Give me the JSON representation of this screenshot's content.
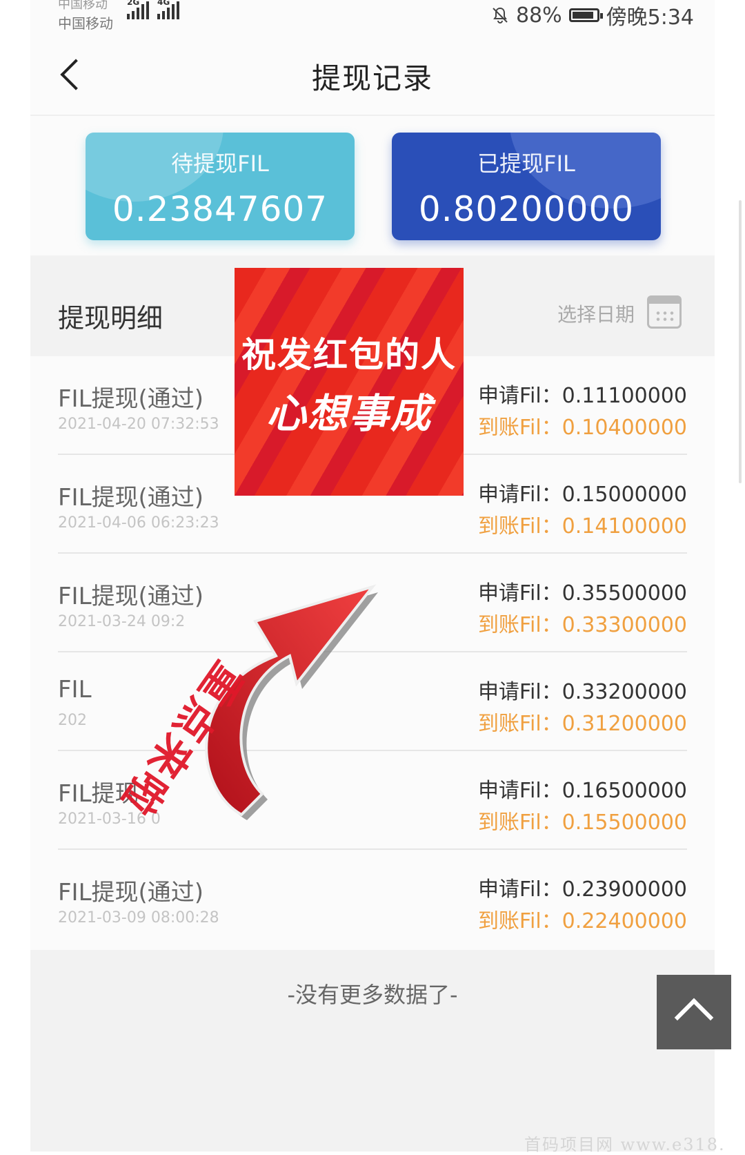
{
  "status_bar": {
    "carrier_top": "中国移动",
    "carrier": "中国移动",
    "signal_1_label": "2G",
    "signal_2_label": "4G",
    "battery": "88%",
    "time": "傍晚5:34"
  },
  "nav": {
    "title": "提现记录"
  },
  "cards": {
    "pending": {
      "label": "待提现FIL",
      "value": "0.23847607"
    },
    "withdrawn": {
      "label": "已提现FIL",
      "value": "0.80200000"
    }
  },
  "details": {
    "title": "提现明细",
    "date_picker": "选择日期"
  },
  "records": [
    {
      "title": "FIL提现(通过)",
      "date": "2021-04-20 07:32:53",
      "apply": "申请Fil：0.11100000",
      "arrive": "到账Fil：0.10400000"
    },
    {
      "title": "FIL提现(通过)",
      "date": "2021-04-06 06:23:23",
      "apply": "申请Fil：0.15000000",
      "arrive": "到账Fil：0.14100000"
    },
    {
      "title": "FIL提现(通过)",
      "date": "2021-03-24 09:2",
      "apply": "申请Fil：0.35500000",
      "arrive": "到账Fil：0.33300000"
    },
    {
      "title": "FIL",
      "date": "202",
      "apply": "申请Fil：0.33200000",
      "arrive": "到账Fil：0.31200000"
    },
    {
      "title": "FIL提现",
      "date": "2021-03-16 0",
      "apply": "申请Fil：0.16500000",
      "arrive": "到账Fil：0.15500000"
    },
    {
      "title": "FIL提现(通过)",
      "date": "2021-03-09 08:00:28",
      "apply": "申请Fil：0.23900000",
      "arrive": "到账Fil：0.22400000"
    }
  ],
  "footer": {
    "no_more": "-没有更多数据了-"
  },
  "overlay": {
    "banner_line1": "祝发红包的人",
    "banner_line2": "心想事成",
    "stamp": "重点来啦"
  },
  "watermark": "首码项目网 www.e318.",
  "colors": {
    "pending_card": "#5ac0d8",
    "withdrawn_card": "#2a4fb8",
    "arrive_text": "#f0a040",
    "banner_red": "#e8281e"
  }
}
